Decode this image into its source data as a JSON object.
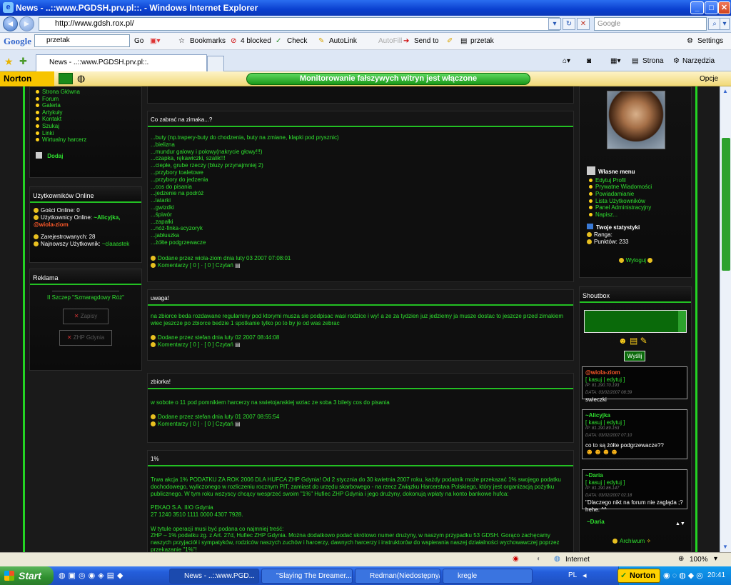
{
  "window": {
    "title": "News - ..::www.PGDSH.prv.pl::. - Windows Internet Explorer"
  },
  "address": {
    "url": "http://www.gdsh.rox.pl/",
    "search_placeholder": "Google"
  },
  "gtoolbar": {
    "logo": "Google",
    "query": "przetak",
    "go": "Go",
    "bookmarks": "Bookmarks",
    "blocked": "4 blocked",
    "check": "Check",
    "autolink": "AutoLink",
    "autofill": "AutoFill",
    "sendto": "Send to",
    "przetak": "przetak",
    "settings": "Settings"
  },
  "tabs": {
    "active": "News - ..::www.PGDSH.prv.pl::.",
    "strona": "Strona",
    "narzedzia": "Narzędzia"
  },
  "norton": {
    "logo": "Norton",
    "banner": "Monitorowanie fałszywych witryn jest włączone",
    "opcje": "Opcje"
  },
  "left": {
    "nav": [
      "Strona Główna",
      "Forum",
      "Galeria",
      "Artykuły",
      "Kontakt",
      "Szukaj",
      "Linki",
      "Wirtualny harcerz"
    ],
    "add": "Dodaj",
    "online_title": "Użytkowników Online",
    "guests": "Gości Online: 0",
    "users_label": "Użytkownicy Online:",
    "users_a": "~Alicyjka,",
    "users_b": "@wiola-ziom",
    "registered": "Zarejestrowanych: 28",
    "newest_label": "Najnowszy Użytkownik:",
    "newest": "~claaastek",
    "ad_title": "Reklama",
    "ad_text": "II Szczep \"Szmaragdowy Róż\"",
    "ad_btn1": "Zapisy",
    "ad_btn2": "ZHP Gdynia"
  },
  "posts": [
    {
      "title": "Co zabrać na zimaka...?",
      "body": "...buty (np.trapery-buty do chodzenia, buty na zmiane, klapki pod prysznic)\n...bielizna\n...mundur galowy i polowy(nakrycie głowy!!!)\n...czapka, rękawiczki, szalik!!!\n...ciepłe, grube rzeczy (bluzy przynajmniej 2)\n...przybory toaletowe\n...przybory do jedzenia\n...cos do pisania\n...jedzenie na podróż\n...latarki\n...gwizdki\n...śpiwór\n...zapałki\n...nóż-finka-scyzoryk\n...jabłuszka\n...żółte podgrzewacze",
      "meta": "Dodane przez wiola-ziom dnia luty 03 2007 07:08:01",
      "comments": "Komentarzy [ 0 ] · [ 0 ] Czytań"
    },
    {
      "title": "uwaga!",
      "body": "na zbiorce beda rozdawane regulaminy pod ktorymi musza sie podpisac wasi rodzice i wy! a ze za tydzien juz jedziemy ja musze dostac to jeszcze przed zimakiem wiec jeszcze po zbiorce bedzie 1 spotkanie tylko po to by je od was zebrac",
      "meta": "Dodane przez stefan dnia luty 02 2007 08:44:08",
      "comments": "Komentarzy [ 0 ] · [ 0 ] Czytań"
    },
    {
      "title": "zbiorka!",
      "body": "w sobote o 11 pod pomnikiem harcerzy na swietojanskiej wziac ze soba 3 bilety cos do pisania",
      "meta": "Dodane przez stefan dnia luty 01 2007 08:55:54",
      "comments": "Komentarzy [ 0 ] · [ 0 ] Czytań"
    },
    {
      "title": "1%",
      "body": "Trwa akcja 1% PODATKU ZA ROK 2006 DLA HUFCA ZHP Gdynia! Od 2 stycznia do 30 kwietnia 2007 roku, każdy podatnik może przekazać 1% swojego podatku dochodowego, wyliczonego w rozliczeniu rocznym PIT, zamiast do urzędu skarbowego - na rzecz Związku Harcerstwa Polskiego, który jest organizacją pożytku publicznego. W tym roku wszyscy chcący wesprzeć swoim \"1%\" Hufiec ZHP Gdynia i jego drużyny, dokonują wpłaty na konto bankowe hufca:\n\nPEKAO S.A. II/O Gdynia\n27 1240 3510 1111 0000 4307 7928.\n\nW tytule operacji musi być podana co najmniej treść:\nZHP – 1% podatku zg. z Art. 27d, Hufiec ZHP Gdynia. Można dodatkowo podać skrótowo numer drużyny, w naszym przypadku 53 GDSH. Gorąco zachęcamy naszych przyjaciół i sympatyków, rodziców naszych zuchów i harcerzy, dawnych harcerzy i instruktorów do wspierania naszej działalności wychowawczej poprzez przekazanie \"1%\"!"
    }
  ],
  "right": {
    "menu_title": "Własne menu",
    "menu": [
      "Edytuj Profil",
      "Prywatne Wiadomości",
      "Powiadamianie",
      "Lista Użytkowników",
      "Panel Administracyjny",
      "Napisz..."
    ],
    "stats_title": "Twoje statystyki",
    "rank": "Ranga:",
    "points": "Punktów: 233",
    "logout": "Wyloguj",
    "shoutbox_title": "Shoutbox",
    "send": "Wyślij",
    "shouts": [
      {
        "name": "@wiola-ziom",
        "actions": "[ kasuj | edytuj ]",
        "ip": "IP: 81.190.70.193",
        "date": "DATA: 03/02/2007 08:39",
        "msg": "swieczki"
      },
      {
        "name": "~Alicyjka",
        "actions": "[ kasuj | edytuj ]",
        "ip": "IP: 81.190.89.153",
        "date": "DATA: 03/02/2007 07:10",
        "msg": "co to są żółte podgrzewacze??"
      },
      {
        "name": "~Daria",
        "actions": "[ kasuj | edytuj ]",
        "ip": "IP: 81.190.86.147",
        "date": "DATA: 03/02/2007 02:18",
        "msg": "\"Dlaczego nikt na forum nie zagląda ;? hehe. ^^"
      }
    ],
    "next_name": "~Daria",
    "archive": "Archiwum"
  },
  "status": {
    "zone": "Internet",
    "zoom": "100%"
  },
  "taskbar": {
    "start": "Start",
    "tasks": [
      "News - ..::www.PGD...",
      "\"Slaying The Dreamer...",
      "Redman(Niedostępny/ )",
      "kregle"
    ],
    "lang": "PL",
    "norton": "Norton",
    "clock": "20:41"
  }
}
